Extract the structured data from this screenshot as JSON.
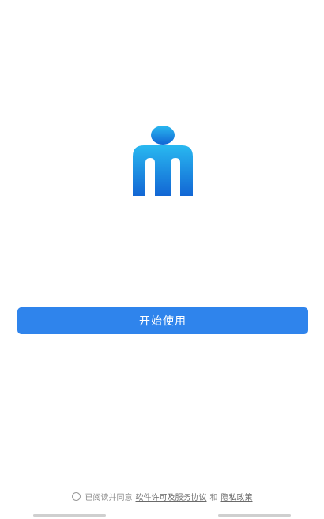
{
  "app": {
    "logo_icon": "person-m-logo-icon",
    "brand_color_top": "#29b8f0",
    "brand_color_bottom": "#1266d4"
  },
  "main": {
    "start_button_label": "开始使用",
    "button_color": "#2f84ec"
  },
  "agreement": {
    "prefix": "已阅读并同意",
    "license_link": "软件许可及服务协议",
    "conjunction": "和",
    "privacy_link": "隐私政策",
    "checked": false
  }
}
